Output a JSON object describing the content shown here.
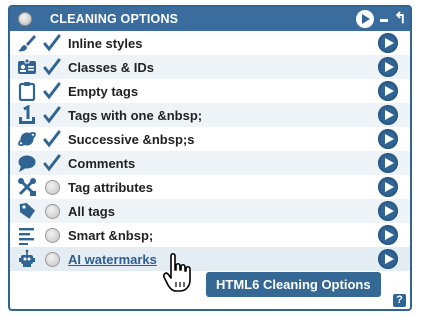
{
  "title": "CLEANING OPTIONS",
  "title_controls": {
    "play_icon": "play-icon",
    "minimize_icon": "minimize-icon",
    "pin_icon": "pin-icon",
    "pin_glyph": "↰"
  },
  "rows": [
    {
      "label": "Inline styles",
      "icon": "paintbrush-icon",
      "checked": true,
      "link": false
    },
    {
      "label": "Classes & IDs",
      "icon": "id-card-icon",
      "checked": true,
      "link": false
    },
    {
      "label": "Empty tags",
      "icon": "clipboard-icon",
      "checked": true,
      "link": false
    },
    {
      "label": "Tags with one &nbsp;",
      "icon": "number-one-icon",
      "checked": true,
      "link": false
    },
    {
      "label": "Successive &nbsp;s",
      "icon": "planet-icon",
      "checked": true,
      "link": false
    },
    {
      "label": "Comments",
      "icon": "speech-bubble-icon",
      "checked": true,
      "link": false
    },
    {
      "label": "Tag attributes",
      "icon": "tools-icon",
      "checked": false,
      "link": false
    },
    {
      "label": "All tags",
      "icon": "tag-icon",
      "checked": false,
      "link": false
    },
    {
      "label": "Smart &nbsp;",
      "icon": "text-lines-icon",
      "checked": false,
      "link": false
    },
    {
      "label": "AI watermarks",
      "icon": "robot-icon",
      "checked": false,
      "link": true
    }
  ],
  "tooltip": "HTML6 Cleaning Options",
  "help_label": "?",
  "colors": {
    "accent": "#2f6493",
    "titlebar": "#3a6d9e",
    "row_alt": "#eef3f8"
  }
}
